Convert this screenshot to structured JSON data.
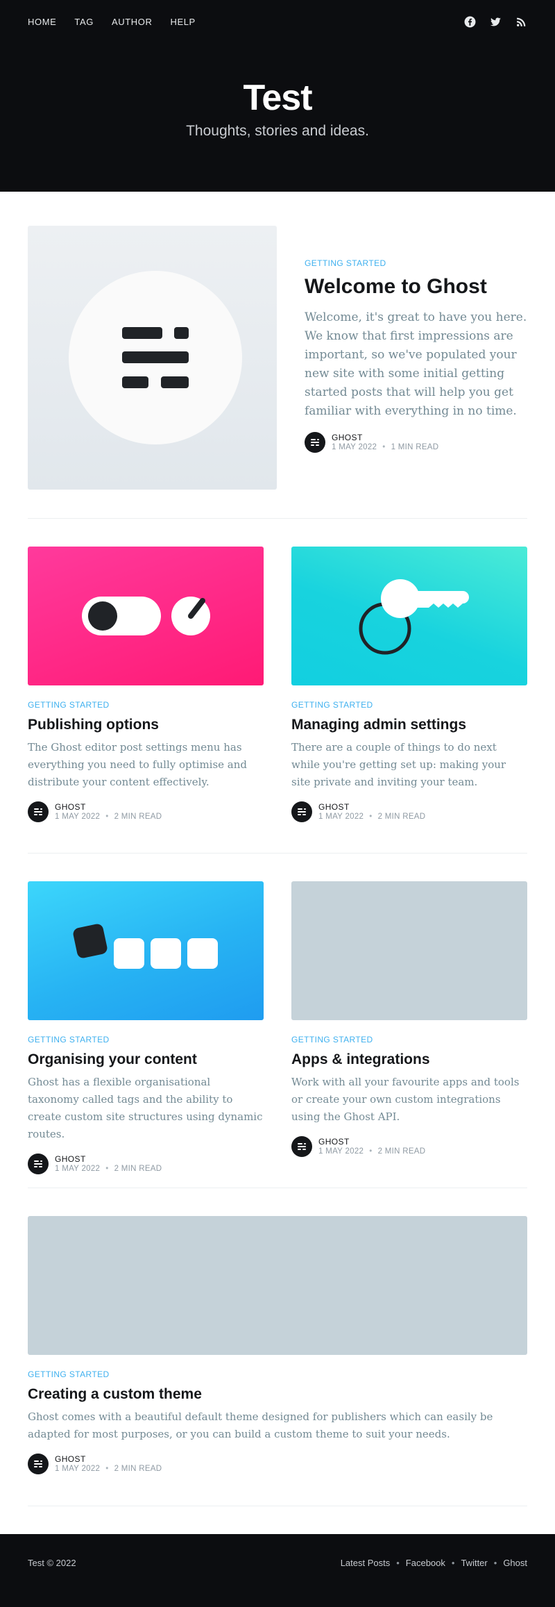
{
  "nav": {
    "items": [
      "HOME",
      "TAG",
      "AUTHOR",
      "HELP"
    ]
  },
  "social": {
    "icons": [
      "facebook-icon",
      "twitter-icon",
      "rss-icon"
    ]
  },
  "site": {
    "title": "Test",
    "description": "Thoughts, stories and ideas."
  },
  "colors": {
    "accent": "#3eb0ef",
    "header_bg": "#0c0d10",
    "excerpt": "#738a94"
  },
  "posts": [
    {
      "tag": "GETTING STARTED",
      "title": "Welcome to Ghost",
      "excerpt": "Welcome, it's great to have you here. We know that first impressions are important, so we've populated your new site with some initial getting started posts that will help you get familiar with everything in no time.",
      "author": "GHOST",
      "date": "1 MAY 2022",
      "read_time": "1 MIN READ"
    },
    {
      "tag": "GETTING STARTED",
      "title": "Publishing options",
      "excerpt": "The Ghost editor post settings menu has everything you need to fully optimise and distribute your content effectively.",
      "author": "GHOST",
      "date": "1 MAY 2022",
      "read_time": "2 MIN READ"
    },
    {
      "tag": "GETTING STARTED",
      "title": "Managing admin settings",
      "excerpt": "There are a couple of things to do next while you're getting set up: making your site private and inviting your team.",
      "author": "GHOST",
      "date": "1 MAY 2022",
      "read_time": "2 MIN READ"
    },
    {
      "tag": "GETTING STARTED",
      "title": "Organising your content",
      "excerpt": "Ghost has a flexible organisational taxonomy called tags and the ability to create custom site structures using dynamic routes.",
      "author": "GHOST",
      "date": "1 MAY 2022",
      "read_time": "2 MIN READ"
    },
    {
      "tag": "GETTING STARTED",
      "title": "Apps & integrations",
      "excerpt": "Work with all your favourite apps and tools or create your own custom integrations using the Ghost API.",
      "author": "GHOST",
      "date": "1 MAY 2022",
      "read_time": "2 MIN READ"
    },
    {
      "tag": "GETTING STARTED",
      "title": "Creating a custom theme",
      "excerpt": "Ghost comes with a beautiful default theme designed for publishers which can easily be adapted for most purposes, or you can build a custom theme to suit your needs.",
      "author": "GHOST",
      "date": "1 MAY 2022",
      "read_time": "2 MIN READ"
    }
  ],
  "footer": {
    "copyright": "Test © 2022",
    "links": [
      "Latest Posts",
      "Facebook",
      "Twitter",
      "Ghost"
    ],
    "separator": "•"
  }
}
